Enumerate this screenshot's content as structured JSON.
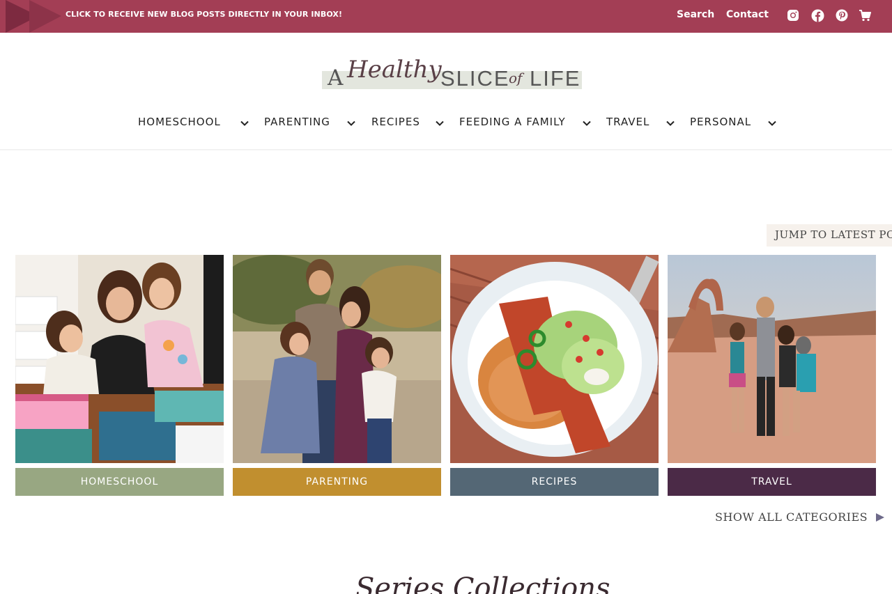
{
  "topbar": {
    "promo": "CLICK TO RECEIVE NEW BLOG POSTS DIRECTLY IN YOUR INBOX!",
    "search": "Search",
    "contact": "Contact",
    "icons": [
      "instagram-icon",
      "facebook-icon",
      "pinterest-icon",
      "cart-icon"
    ],
    "bg_color": "#a33e55"
  },
  "logo": {
    "a": "A",
    "script": "Healthy",
    "slice": "SLICE",
    "of": "of",
    "life": "LIFE"
  },
  "nav": {
    "items": [
      {
        "label": "HOMESCHOOL"
      },
      {
        "label": "PARENTING"
      },
      {
        "label": "RECIPES"
      },
      {
        "label": "FEEDING A FAMILY"
      },
      {
        "label": "TRAVEL"
      },
      {
        "label": "PERSONAL"
      }
    ]
  },
  "jump": {
    "label": "JUMP TO LATEST POST"
  },
  "categories": [
    {
      "label": "HOMESCHOOL",
      "color": "#98a782"
    },
    {
      "label": "PARENTING",
      "color": "#c18f2f"
    },
    {
      "label": "RECIPES",
      "color": "#546775"
    },
    {
      "label": "TRAVEL",
      "color": "#4b2a47"
    }
  ],
  "show_all": "SHOW ALL CATEGORIES",
  "bottom_heading": "Series Collections"
}
